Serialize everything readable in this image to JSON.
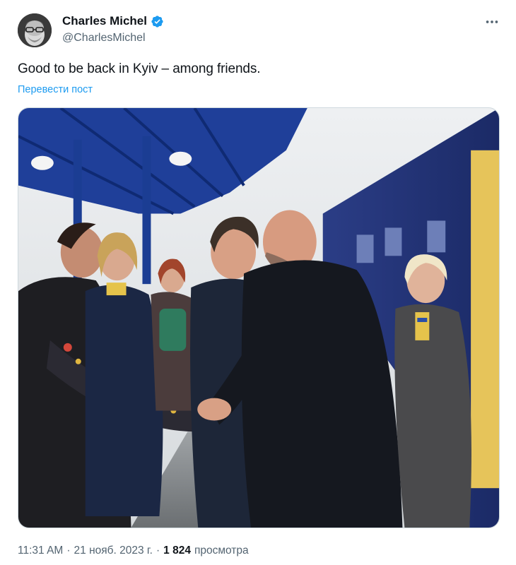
{
  "author": {
    "name": "Charles Michel",
    "handle": "@CharlesMichel",
    "verified": true,
    "avatar_icon": "profile-avatar"
  },
  "tweet": {
    "text": "Good to be back in Kyiv – among friends.",
    "translate_label": "Перевести пост"
  },
  "media": {
    "type": "photo",
    "icon": "photo-image"
  },
  "meta": {
    "time": "11:31 AM",
    "separator": "·",
    "date": "21 нояб. 2023 г.",
    "separator2": "·",
    "views_count": "1 824",
    "views_label": "просмотра"
  },
  "colors": {
    "accent": "#1d9bf0",
    "text": "#0f1419",
    "secondary": "#536471",
    "border": "#cfd9de"
  }
}
